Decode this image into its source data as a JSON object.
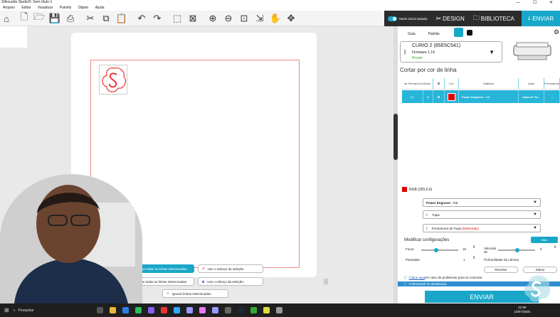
{
  "app": {
    "title": "Silhouette Studio®: Sem título-1",
    "window_controls": "— ☐ ✕"
  },
  "menu": [
    "Arquivo",
    "Editar",
    "Visualizar",
    "Painéis",
    "Objeto",
    "Ajuda"
  ],
  "nav": {
    "modo_label": "Modo inicial ativado",
    "design": "DESIGN",
    "biblioteca": "BIBLIOTECA",
    "enviar": "ENVIAR"
  },
  "panel": {
    "tabs": [
      "Guia",
      "Padrão"
    ],
    "device": {
      "name": "CURIO 2 (85E5C541)",
      "firmware": "Firmware 1.14",
      "status": "Pronto"
    },
    "heading": "Cortar por cor de linha",
    "table": {
      "headers": [
        "de Ferrame-rfo/Destl",
        "Cor",
        "Material",
        "Ação",
        "Ferramenta"
      ],
      "row": {
        "material": "Power Engraver - C2",
        "acao": "Ação de Tu..."
      }
    },
    "rgb": "RGB (255,0,0)",
    "selects": [
      "Power Engraver - C2",
      "Tupia",
      "Ferramenta de Tupia"
    ],
    "tupia_detected": "(Detectado)",
    "modificar": "Modificar configurações",
    "mais": "Mais",
    "forca_label": "Força",
    "forca_value": "15",
    "velocidade_label": "Velocida de",
    "velocidade_value": "5",
    "passadas_label": "Passadas",
    "passadas_value": "1",
    "profundidade_label": "Profundidade da Lâmina",
    "reverter": "Reverter",
    "salvar": "Salvar",
    "info1_link": "Clique aqui",
    "info1_text": " em caso de problemas para se conectar.",
    "info2": "O Bluetooth foi desativado.",
    "enviar": "ENVIAR"
  },
  "popup": {
    "b1": "Use todas as linhas selecionadas",
    "b2": "Use o esboço da seleção",
    "b3": "Use todas as linhas selecionadas",
    "b4": "Use o esboço da seleção-",
    "b5": "Ignorar linhas selecionadas"
  },
  "taskbar": {
    "search": "Pesquisar",
    "time": "21:59",
    "date": "10/07/2025"
  },
  "colors": {
    "accent": "#19a7c9",
    "red": "#e00000"
  }
}
